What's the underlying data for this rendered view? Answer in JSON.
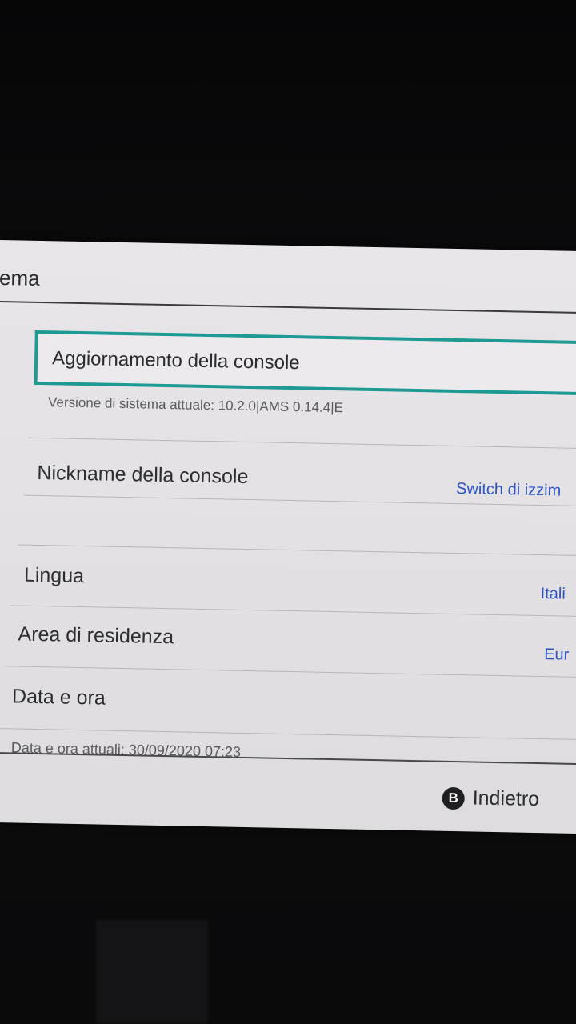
{
  "header": {
    "title": "ema"
  },
  "settings": {
    "console_update": {
      "label": "Aggiornamento della console",
      "detail": "Versione di sistema attuale: 10.2.0|AMS 0.14.4|E"
    },
    "nickname": {
      "label": "Nickname della console",
      "value": "Switch di izzim"
    },
    "language": {
      "label": "Lingua",
      "value": "Itali"
    },
    "region": {
      "label": "Area di residenza",
      "value": "Eur"
    },
    "datetime": {
      "label": "Data e ora",
      "detail": "Data e ora attuali: 30/09/2020 07:23"
    }
  },
  "footer": {
    "back_icon": "B",
    "back_label": "Indietro"
  },
  "colors": {
    "selection": "#1e9a93",
    "value_text": "#2d55c8",
    "background": "#e3e1e3"
  }
}
